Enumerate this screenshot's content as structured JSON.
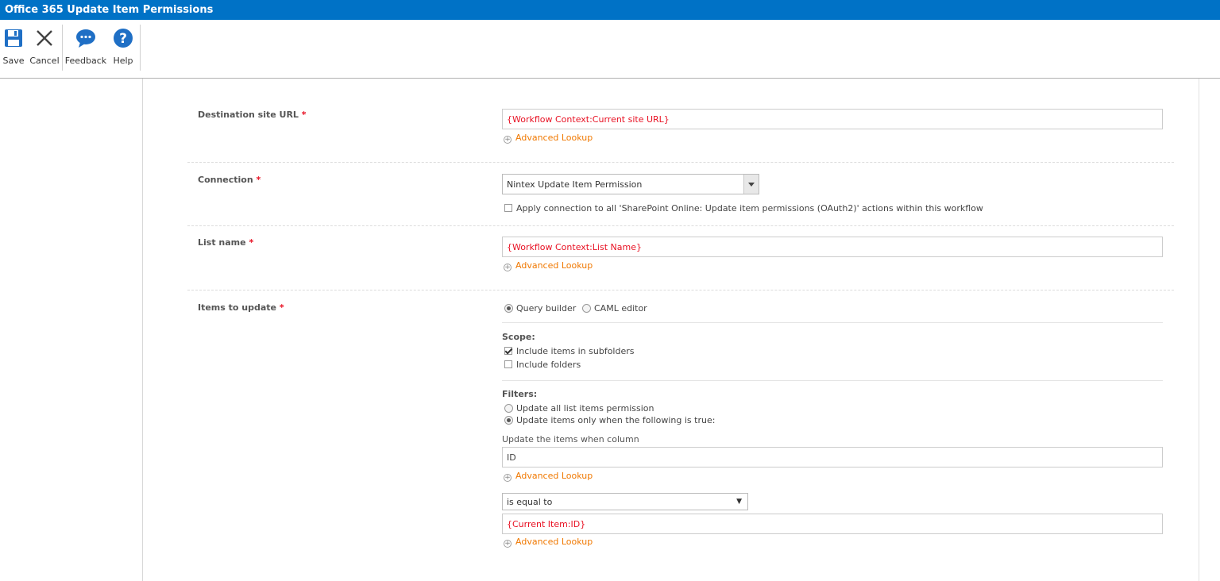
{
  "window": {
    "title": "Office 365 Update Item Permissions"
  },
  "ribbon": {
    "save_label": "Save",
    "cancel_label": "Cancel",
    "feedback_label": "Feedback",
    "help_label": "Help"
  },
  "colors": {
    "accent": "#0072c6",
    "required": "#e81123",
    "lookup": "#f07800",
    "reference": "#e81123"
  },
  "form": {
    "destination": {
      "label": "Destination site URL",
      "required_mark": "*",
      "value": "{Workflow Context:Current site URL}",
      "lookup_label": "Advanced Lookup"
    },
    "connection": {
      "label": "Connection",
      "required_mark": "*",
      "selected": "Nintex Update Item Permission",
      "apply_all_label": "Apply connection to all 'SharePoint Online: Update item permissions (OAuth2)' actions within this workflow",
      "apply_all_checked": false
    },
    "list_name": {
      "label": "List name",
      "required_mark": "*",
      "value": "{Workflow Context:List Name}",
      "lookup_label": "Advanced Lookup"
    },
    "items": {
      "label": "Items to update",
      "required_mark": "*",
      "mode_query_builder": "Query builder",
      "mode_caml_editor": "CAML editor",
      "mode_selected": "Query builder",
      "scope_title": "Scope:",
      "include_subfolders_label": "Include items in subfolders",
      "include_subfolders_checked": true,
      "include_folders_label": "Include folders",
      "include_folders_checked": false,
      "filters_title": "Filters:",
      "filter_all_label": "Update all list items permission",
      "filter_when_label": "Update items only when the following is true:",
      "filter_selected": "Update items only when the following is true:",
      "column_prompt": "Update the items when column",
      "column_value": "ID",
      "column_lookup_label": "Advanced Lookup",
      "operator_selected": "is equal to",
      "compare_value": "{Current Item:ID}",
      "compare_lookup_label": "Advanced Lookup"
    }
  }
}
